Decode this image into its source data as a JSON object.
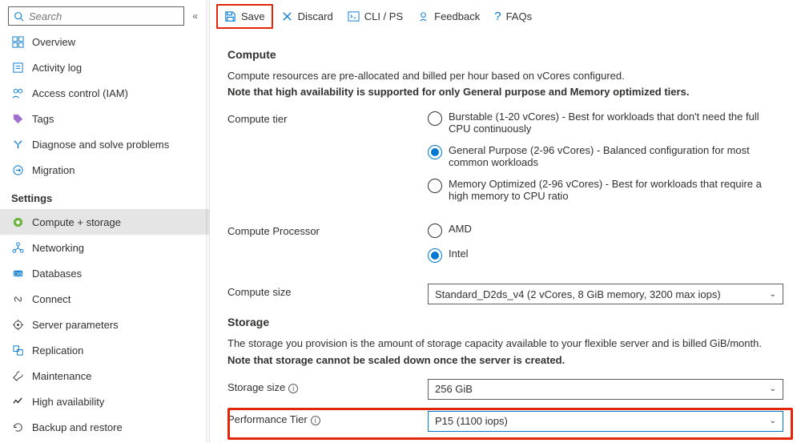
{
  "search": {
    "placeholder": "Search"
  },
  "nav": {
    "top": [
      {
        "label": "Overview"
      },
      {
        "label": "Activity log"
      },
      {
        "label": "Access control (IAM)"
      },
      {
        "label": "Tags"
      },
      {
        "label": "Diagnose and solve problems"
      },
      {
        "label": "Migration"
      }
    ],
    "settings_header": "Settings",
    "settings": [
      {
        "label": "Compute + storage"
      },
      {
        "label": "Networking"
      },
      {
        "label": "Databases"
      },
      {
        "label": "Connect"
      },
      {
        "label": "Server parameters"
      },
      {
        "label": "Replication"
      },
      {
        "label": "Maintenance"
      },
      {
        "label": "High availability"
      },
      {
        "label": "Backup and restore"
      }
    ]
  },
  "toolbar": {
    "save": "Save",
    "discard": "Discard",
    "cli": "CLI / PS",
    "feedback": "Feedback",
    "faqs": "FAQs"
  },
  "compute": {
    "heading": "Compute",
    "desc": "Compute resources are pre-allocated and billed per hour based on vCores configured.",
    "note": "Note that high availability is supported for only General purpose and Memory optimized tiers.",
    "tier_label": "Compute tier",
    "tiers": [
      "Burstable (1-20 vCores) - Best for workloads that don't need the full CPU continuously",
      "General Purpose (2-96 vCores) - Balanced configuration for most common workloads",
      "Memory Optimized (2-96 vCores) - Best for workloads that require a high memory to CPU ratio"
    ],
    "processor_label": "Compute Processor",
    "processors": [
      "AMD",
      "Intel"
    ],
    "size_label": "Compute size",
    "size_value": "Standard_D2ds_v4 (2 vCores, 8 GiB memory, 3200 max iops)"
  },
  "storage": {
    "heading": "Storage",
    "desc": "The storage you provision is the amount of storage capacity available to your flexible server and is billed GiB/month.",
    "note": "Note that storage cannot be scaled down once the server is created.",
    "size_label": "Storage size",
    "size_value": "256 GiB",
    "perf_label": "Performance Tier",
    "perf_value": "P15 (1100 iops)"
  }
}
